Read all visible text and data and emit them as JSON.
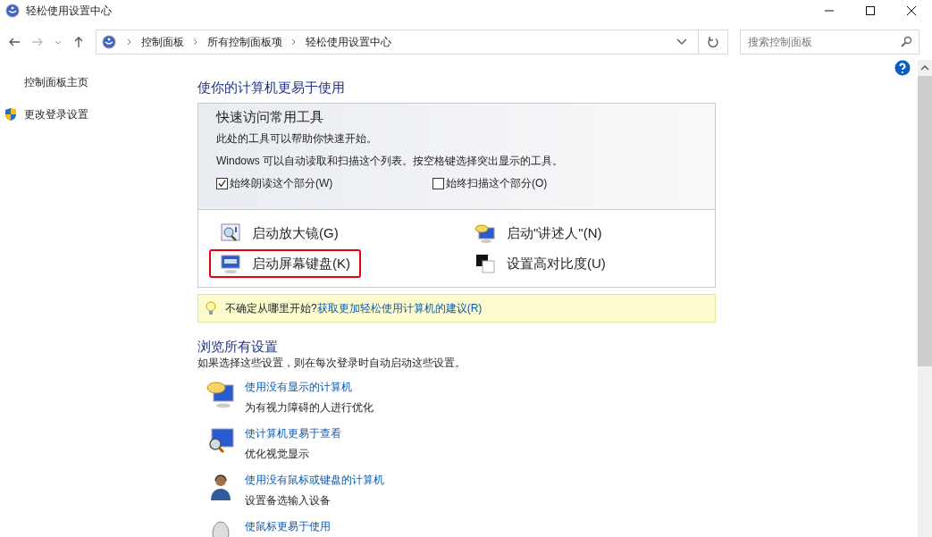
{
  "window": {
    "title": "轻松使用设置中心"
  },
  "address_bar": {
    "path": [
      "控制面板",
      "所有控制面板项",
      "轻松使用设置中心"
    ]
  },
  "search": {
    "placeholder": "搜索控制面板"
  },
  "sidebar": {
    "items": [
      {
        "label": "控制面板主页",
        "kind": "plain"
      },
      {
        "label": "更改登录设置",
        "kind": "shield"
      }
    ]
  },
  "heading": "使你的计算机更易于使用",
  "quick_access": {
    "title": "快速访问常用工具",
    "lines": [
      "此处的工具可以帮助你快速开始。",
      "Windows 可以自动读取和扫描这个列表。按空格键选择突出显示的工具。"
    ],
    "options": [
      {
        "label": "始终朗读这个部分(W)",
        "checked": true
      },
      {
        "label": "始终扫描这个部分(O)",
        "checked": false
      }
    ],
    "tools": [
      {
        "label": "启动放大镜(G)",
        "kind": "magnifier",
        "highlighted": false
      },
      {
        "label": "启动\"讲述人\"(N)",
        "kind": "narrator",
        "highlighted": false
      },
      {
        "label": "启动屏幕键盘(K)",
        "kind": "keyboard",
        "highlighted": true
      },
      {
        "label": "设置高对比度(U)",
        "kind": "contrast",
        "highlighted": false
      }
    ]
  },
  "tip": {
    "text": "不确定从哪里开始?",
    "link": "获取更加轻松使用计算机的建议(R)"
  },
  "browse": {
    "title": "浏览所有设置",
    "subtitle": "如果选择这些设置，则在每次登录时自动启动这些设置。",
    "items": [
      {
        "link": "使用没有显示的计算机",
        "description": "为有视力障碍的人进行优化",
        "kind": "speech"
      },
      {
        "link": "使计算机更易于查看",
        "description": "优化视觉显示",
        "kind": "view"
      },
      {
        "link": "使用没有鼠标或键盘的计算机",
        "description": "设置备选输入设备",
        "kind": "person"
      },
      {
        "link": "使鼠标更易于使用",
        "kind": "mouse"
      }
    ]
  }
}
